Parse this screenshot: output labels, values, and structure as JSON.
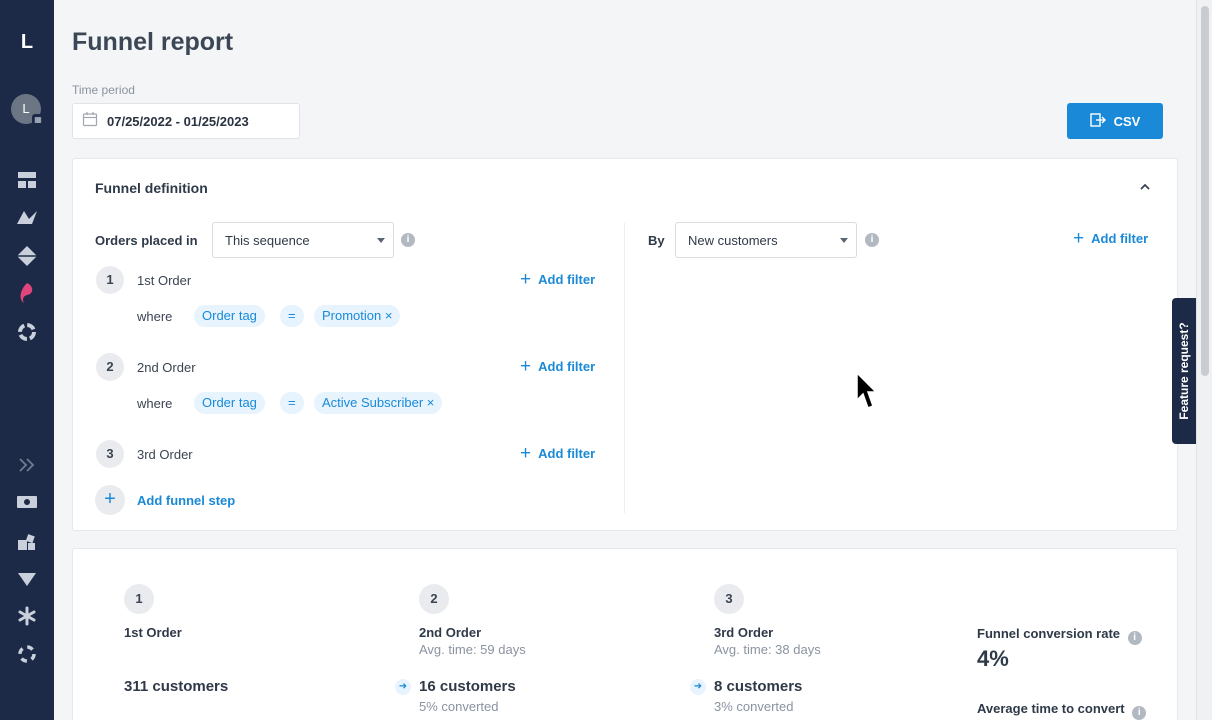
{
  "sidebar": {
    "logo": "L",
    "avatar_initial": "L",
    "icons": [
      "dashboard-icon",
      "analytics-icon",
      "diamond-icon",
      "brand-icon",
      "segments-icon",
      "expand-icon",
      "money-icon",
      "apps-icon",
      "filter-icon",
      "asterisk-icon",
      "help-icon"
    ]
  },
  "header": {
    "title": "Funnel report",
    "time_period_label": "Time period",
    "date_range": "07/25/2022 - 01/25/2023",
    "csv_button": "CSV"
  },
  "definition": {
    "title": "Funnel definition",
    "orders_placed_label": "Orders placed in",
    "sequence_select": "This sequence",
    "by_label": "By",
    "by_select": "New customers",
    "add_filter": "Add filter",
    "where_label": "where",
    "steps": [
      {
        "num": "1",
        "label": "1st Order",
        "filter": {
          "field": "Order tag",
          "op": "=",
          "value": "Promotion ×"
        }
      },
      {
        "num": "2",
        "label": "2nd Order",
        "filter": {
          "field": "Order tag",
          "op": "=",
          "value": "Active Subscriber ×"
        }
      },
      {
        "num": "3",
        "label": "3rd Order"
      }
    ],
    "add_step": "Add funnel step"
  },
  "results": {
    "steps": [
      {
        "num": "1",
        "name": "1st Order",
        "count": "311 customers"
      },
      {
        "num": "2",
        "name": "2nd Order",
        "avg": "Avg. time: 59 days",
        "count": "16 customers",
        "converted": "5% converted"
      },
      {
        "num": "3",
        "name": "3rd Order",
        "avg": "Avg. time: 38 days",
        "count": "8 customers",
        "converted": "3% converted"
      }
    ],
    "conversion_label": "Funnel conversion rate",
    "conversion_value": "4%",
    "avg_time_label": "Average time to convert"
  },
  "feature_request": "Feature request?",
  "colors": {
    "sidebar": "#1c2a47",
    "accent": "#1a8ad8",
    "chip_bg": "#e7f3fd"
  }
}
